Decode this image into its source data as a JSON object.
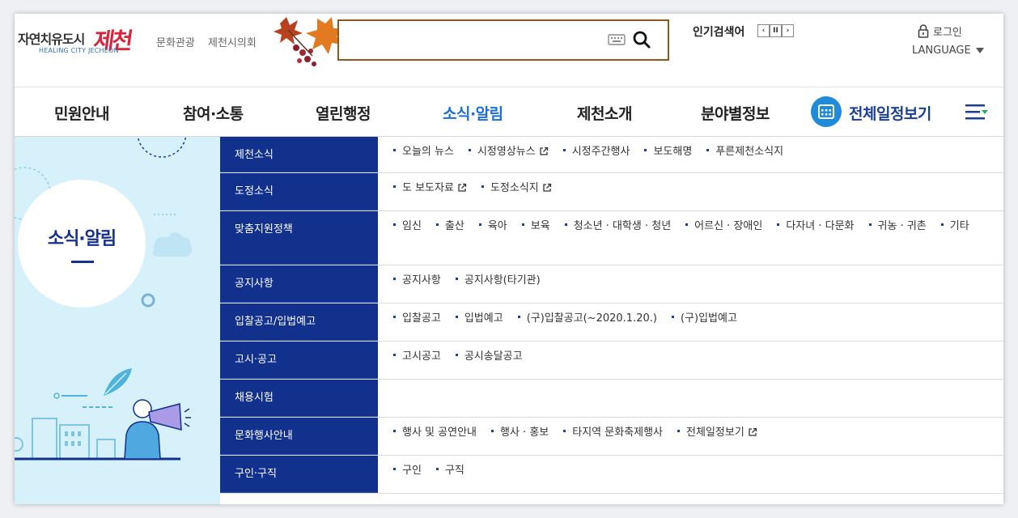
{
  "header": {
    "logo_text": "자연치유도시",
    "logo_brush": "제천",
    "logo_sub": "HEALING CITY JECHEON",
    "top_links": [
      "문화관광",
      "제천시의회"
    ],
    "search": {
      "placeholder": ""
    },
    "popular_label": "인기검색어",
    "popular_controls": [
      "‹",
      "II",
      "›"
    ],
    "login_label": "로그인",
    "language_label": "LANGUAGE"
  },
  "nav": {
    "items": [
      {
        "label": "민원안내",
        "active": false
      },
      {
        "label": "참여·소통",
        "active": false
      },
      {
        "label": "열린행정",
        "active": false
      },
      {
        "label": "소식·알림",
        "active": true
      },
      {
        "label": "제천소개",
        "active": false
      },
      {
        "label": "분야별정보",
        "active": false
      }
    ],
    "calendar_label": "전체일정보기"
  },
  "panel": {
    "title": "소식·알림"
  },
  "menu": [
    {
      "head": "제천소식",
      "links": [
        {
          "t": "오늘의 뉴스",
          "ext": false
        },
        {
          "t": "시정영상뉴스",
          "ext": true
        },
        {
          "t": "시정주간행사",
          "ext": false
        },
        {
          "t": "보도해명",
          "ext": false
        },
        {
          "t": "푸른제천소식지",
          "ext": false
        }
      ]
    },
    {
      "head": "도정소식",
      "links": [
        {
          "t": "도 보도자료",
          "ext": true
        },
        {
          "t": "도정소식지",
          "ext": true
        }
      ]
    },
    {
      "head": "맞춤지원정책",
      "links": [
        {
          "t": "임신",
          "ext": false
        },
        {
          "t": "출산",
          "ext": false
        },
        {
          "t": "육아",
          "ext": false
        },
        {
          "t": "보육",
          "ext": false
        },
        {
          "t": "청소년 · 대학생 · 청년",
          "ext": false
        },
        {
          "t": "어르신 · 장애인",
          "ext": false
        },
        {
          "t": "다자녀 · 다문화",
          "ext": false
        },
        {
          "t": "귀농 · 귀촌",
          "ext": false
        },
        {
          "t": "기타",
          "ext": false
        }
      ]
    },
    {
      "head": "공지사항",
      "links": [
        {
          "t": "공지사항",
          "ext": false
        },
        {
          "t": "공지사항(타기관)",
          "ext": false
        }
      ]
    },
    {
      "head": "입찰공고/입법예고",
      "links": [
        {
          "t": "입찰공고",
          "ext": false
        },
        {
          "t": "입법예고",
          "ext": false
        },
        {
          "t": "(구)입찰공고(~2020.1.20.)",
          "ext": false
        },
        {
          "t": "(구)입법예고",
          "ext": false
        }
      ]
    },
    {
      "head": "고시·공고",
      "links": [
        {
          "t": "고시공고",
          "ext": false
        },
        {
          "t": "공시송달공고",
          "ext": false
        }
      ]
    },
    {
      "head": "채용시험",
      "links": []
    },
    {
      "head": "문화행사안내",
      "links": [
        {
          "t": "행사 및 공연안내",
          "ext": false
        },
        {
          "t": "행사 · 홍보",
          "ext": false
        },
        {
          "t": "타지역 문화축제행사",
          "ext": false
        },
        {
          "t": "전체일정보기",
          "ext": true
        }
      ]
    },
    {
      "head": "구인·구직",
      "links": [
        {
          "t": "구인",
          "ext": false
        },
        {
          "t": "구직",
          "ext": false
        }
      ]
    }
  ],
  "colors": {
    "accent": "#1f6fd1",
    "navy": "#12318c",
    "panel_bg": "#d7f1fb",
    "search_border": "#8b5a1e",
    "brand_red": "#d4263c"
  }
}
